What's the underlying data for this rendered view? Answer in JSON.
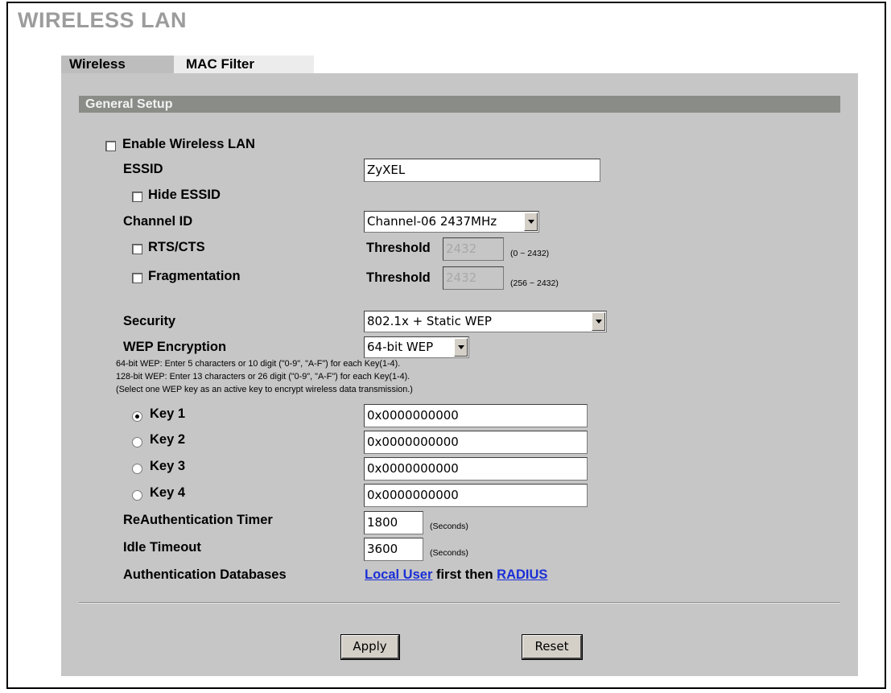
{
  "page": {
    "title": "WIRELESS LAN"
  },
  "tabs": [
    {
      "label": "Wireless"
    },
    {
      "label": "MAC Filter"
    }
  ],
  "section": {
    "title": "General Setup"
  },
  "enable_wlan": {
    "label": "Enable Wireless LAN",
    "checked": false
  },
  "essid": {
    "label": "ESSID",
    "value": "ZyXEL"
  },
  "hide_essid": {
    "label": "Hide ESSID",
    "checked": false
  },
  "channel": {
    "label": "Channel ID",
    "value": "Channel-06 2437MHz"
  },
  "rts_cts": {
    "label": "RTS/CTS",
    "threshold_label": "Threshold",
    "threshold_value": "2432",
    "range": "(0 ~ 2432)"
  },
  "fragmentation": {
    "label": "Fragmentation",
    "threshold_label": "Threshold",
    "threshold_value": "2432",
    "range": "(256 ~ 2432)"
  },
  "security": {
    "label": "Security",
    "value": "802.1x + Static WEP"
  },
  "wep": {
    "label": "WEP Encryption",
    "value": "64-bit WEP",
    "notes": [
      "64-bit WEP: Enter 5 characters or 10 digit (\"0-9\", \"A-F\") for each Key(1-4).",
      "128-bit WEP: Enter 13 characters or 26 digit (\"0-9\", \"A-F\") for each Key(1-4).",
      "(Select one WEP key as an active key to encrypt wireless data transmission.)"
    ]
  },
  "keys": [
    {
      "label": "Key 1",
      "value": "0x0000000000",
      "selected": true
    },
    {
      "label": "Key 2",
      "value": "0x0000000000",
      "selected": false
    },
    {
      "label": "Key 3",
      "value": "0x0000000000",
      "selected": false
    },
    {
      "label": "Key 4",
      "value": "0x0000000000",
      "selected": false
    }
  ],
  "reauth": {
    "label": "ReAuthentication Timer",
    "value": "1800",
    "unit": "(Seconds)"
  },
  "idle": {
    "label": "Idle Timeout",
    "value": "3600",
    "unit": "(Seconds)"
  },
  "auth_db": {
    "label": "Authentication Databases",
    "link1": "Local User",
    "middle": "first then",
    "link2": "RADIUS"
  },
  "buttons": {
    "apply": "Apply",
    "reset": "Reset"
  }
}
